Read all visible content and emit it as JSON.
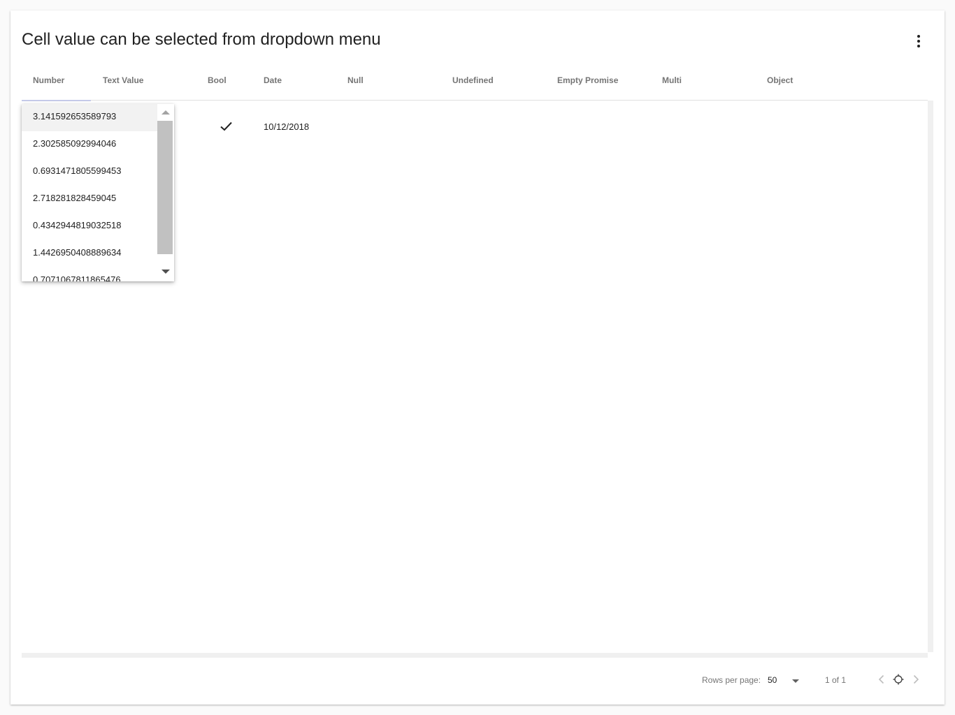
{
  "card": {
    "title": "Cell value can be selected from dropdown menu",
    "menu_icon": "more-vertical-icon"
  },
  "table": {
    "columns": [
      "Number",
      "Text Value",
      "Bool",
      "Date",
      "Null",
      "Undefined",
      "Empty Promise",
      "Multi",
      "Object"
    ],
    "rows": [
      {
        "bool_icon": "check-icon",
        "bool": true,
        "date": "10/12/2018"
      }
    ]
  },
  "dropdown": {
    "options": [
      "3.141592653589793",
      "2.302585092994046",
      "0.6931471805599453",
      "2.718281828459045",
      "0.4342944819032518",
      "1.4426950408889634",
      "0.7071067811865476"
    ],
    "selected_index": 0,
    "scroll_up_icon": "triangle-up-icon",
    "scroll_down_icon": "triangle-down-icon"
  },
  "footer": {
    "rows_per_page_label": "Rows per page:",
    "rows_per_page_value": "50",
    "page_info": "1 of 1",
    "prev_icon": "chevron-left-icon",
    "first_icon": "circle-icon",
    "next_icon": "chevron-right-icon"
  },
  "colors": {
    "header_text": "#757575",
    "selected_option_bg": "#f2f2f2",
    "edit_underline": "#c5cae9"
  }
}
